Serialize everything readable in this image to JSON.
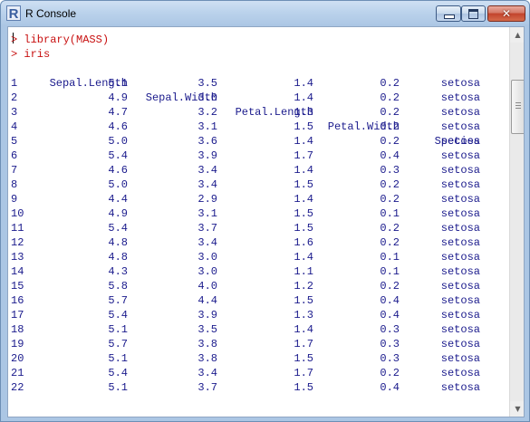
{
  "window": {
    "title": "R Console",
    "icon": "r-logo-icon",
    "buttons": {
      "minimize": "minimize-icon",
      "maximize": "maximize-icon",
      "close": "close-icon",
      "close_glyph": "✕"
    }
  },
  "console": {
    "commands": [
      "> library(MASS)",
      "> iris"
    ],
    "header": {
      "c1": "Sepal.Length",
      "c2": "Sepal.Width",
      "c3": "Petal.Length",
      "c4": "Petal.Width",
      "c5": "Species"
    },
    "rows": [
      {
        "n": "1",
        "c1": "5.1",
        "c2": "3.5",
        "c3": "1.4",
        "c4": "0.2",
        "c5": "setosa"
      },
      {
        "n": "2",
        "c1": "4.9",
        "c2": "3.0",
        "c3": "1.4",
        "c4": "0.2",
        "c5": "setosa"
      },
      {
        "n": "3",
        "c1": "4.7",
        "c2": "3.2",
        "c3": "1.3",
        "c4": "0.2",
        "c5": "setosa"
      },
      {
        "n": "4",
        "c1": "4.6",
        "c2": "3.1",
        "c3": "1.5",
        "c4": "0.2",
        "c5": "setosa"
      },
      {
        "n": "5",
        "c1": "5.0",
        "c2": "3.6",
        "c3": "1.4",
        "c4": "0.2",
        "c5": "setosa"
      },
      {
        "n": "6",
        "c1": "5.4",
        "c2": "3.9",
        "c3": "1.7",
        "c4": "0.4",
        "c5": "setosa"
      },
      {
        "n": "7",
        "c1": "4.6",
        "c2": "3.4",
        "c3": "1.4",
        "c4": "0.3",
        "c5": "setosa"
      },
      {
        "n": "8",
        "c1": "5.0",
        "c2": "3.4",
        "c3": "1.5",
        "c4": "0.2",
        "c5": "setosa"
      },
      {
        "n": "9",
        "c1": "4.4",
        "c2": "2.9",
        "c3": "1.4",
        "c4": "0.2",
        "c5": "setosa"
      },
      {
        "n": "10",
        "c1": "4.9",
        "c2": "3.1",
        "c3": "1.5",
        "c4": "0.1",
        "c5": "setosa"
      },
      {
        "n": "11",
        "c1": "5.4",
        "c2": "3.7",
        "c3": "1.5",
        "c4": "0.2",
        "c5": "setosa"
      },
      {
        "n": "12",
        "c1": "4.8",
        "c2": "3.4",
        "c3": "1.6",
        "c4": "0.2",
        "c5": "setosa"
      },
      {
        "n": "13",
        "c1": "4.8",
        "c2": "3.0",
        "c3": "1.4",
        "c4": "0.1",
        "c5": "setosa"
      },
      {
        "n": "14",
        "c1": "4.3",
        "c2": "3.0",
        "c3": "1.1",
        "c4": "0.1",
        "c5": "setosa"
      },
      {
        "n": "15",
        "c1": "5.8",
        "c2": "4.0",
        "c3": "1.2",
        "c4": "0.2",
        "c5": "setosa"
      },
      {
        "n": "16",
        "c1": "5.7",
        "c2": "4.4",
        "c3": "1.5",
        "c4": "0.4",
        "c5": "setosa"
      },
      {
        "n": "17",
        "c1": "5.4",
        "c2": "3.9",
        "c3": "1.3",
        "c4": "0.4",
        "c5": "setosa"
      },
      {
        "n": "18",
        "c1": "5.1",
        "c2": "3.5",
        "c3": "1.4",
        "c4": "0.3",
        "c5": "setosa"
      },
      {
        "n": "19",
        "c1": "5.7",
        "c2": "3.8",
        "c3": "1.7",
        "c4": "0.3",
        "c5": "setosa"
      },
      {
        "n": "20",
        "c1": "5.1",
        "c2": "3.8",
        "c3": "1.5",
        "c4": "0.3",
        "c5": "setosa"
      },
      {
        "n": "21",
        "c1": "5.4",
        "c2": "3.4",
        "c3": "1.7",
        "c4": "0.2",
        "c5": "setosa"
      },
      {
        "n": "22",
        "c1": "5.1",
        "c2": "3.7",
        "c3": "1.5",
        "c4": "0.4",
        "c5": "setosa"
      }
    ]
  },
  "colors": {
    "command": "#c81010",
    "output": "#1a1a8c"
  },
  "scrollbar": {
    "up_arrow": "▲",
    "down_arrow": "▼",
    "position_fraction": 0.12
  }
}
